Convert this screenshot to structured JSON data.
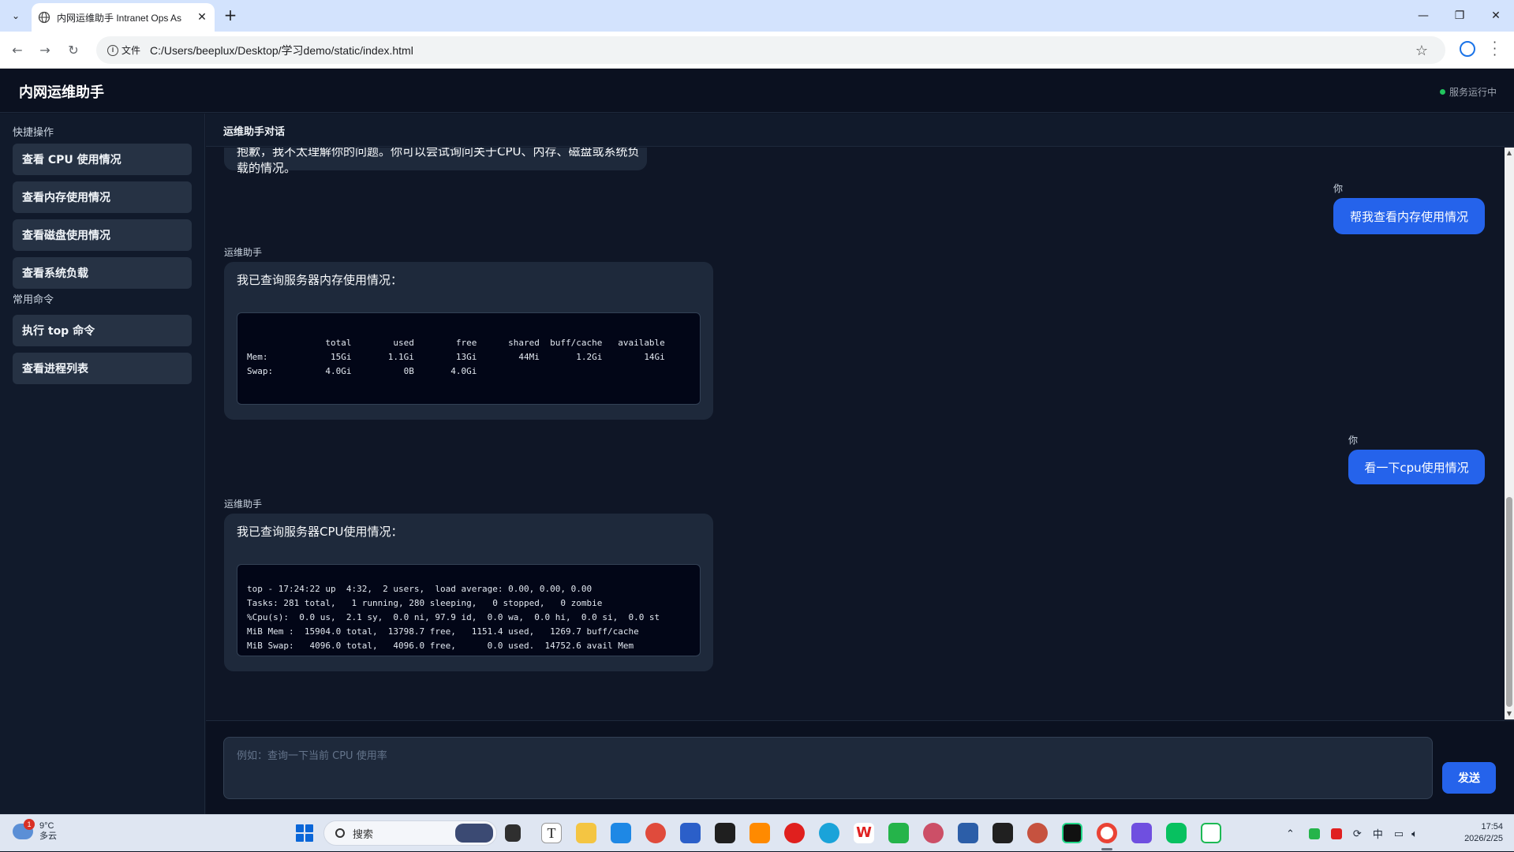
{
  "browser": {
    "tab_title": "内网运维助手 Intranet Ops As",
    "url_chip": "文件",
    "url": "C:/Users/beeplux/Desktop/学习demo/static/index.html"
  },
  "app": {
    "title": "内网运维助手",
    "status": "服务运行中",
    "accent": "#2563eb",
    "status_color": "#22c55e"
  },
  "sidebar": {
    "quick_title": "快捷操作",
    "quick_actions": [
      "查看 CPU 使用情况",
      "查看内存使用情况",
      "查看磁盘使用情况",
      "查看系统负载"
    ],
    "common_title": "常用命令",
    "commands": [
      "执行 top 命令",
      "查看进程列表"
    ]
  },
  "chat": {
    "header": "运维助手对话",
    "messages": [
      {
        "role": "assistant",
        "text": "抱歉，我不太理解你的问题。你可以尝试询问关于CPU、内存、磁盘或系统负载的情况。"
      },
      {
        "role": "user",
        "sender": "你",
        "text": "帮我查看内存使用情况"
      },
      {
        "role": "assistant",
        "sender": "运维助手",
        "text": "我已查询服务器内存使用情况：",
        "terminal": "               total        used        free      shared  buff/cache   available\nMem:            15Gi       1.1Gi        13Gi        44Mi       1.2Gi        14Gi\nSwap:          4.0Gi          0B       4.0Gi"
      },
      {
        "role": "user",
        "sender": "你",
        "text": "看一下cpu使用情况"
      },
      {
        "role": "assistant",
        "sender": "运维助手",
        "text": "我已查询服务器CPU使用情况：",
        "terminal": "top - 17:24:22 up  4:32,  2 users,  load average: 0.00, 0.00, 0.00\nTasks: 281 total,   1 running, 280 sleeping,   0 stopped,   0 zombie\n%Cpu(s):  0.0 us,  2.1 sy,  0.0 ni, 97.9 id,  0.0 wa,  0.0 hi,  0.0 si,  0.0 st\nMiB Mem :  15904.0 total,  13798.7 free,   1151.4 used,   1269.7 buff/cache\nMiB Swap:   4096.0 total,   4096.0 free,      0.0 used.  14752.6 avail Mem"
      }
    ]
  },
  "composer": {
    "placeholder": "例如：查询一下当前 CPU 使用率",
    "send_label": "发送"
  },
  "taskbar": {
    "temperature": "9°C",
    "weather": "多云",
    "weather_badge": "1",
    "search_label": "搜索",
    "ime": "中",
    "time": "17:54",
    "date": "2026/2/25",
    "apps": [
      "file-icon",
      "typora-icon",
      "file-explorer-icon",
      "screen-capture-icon",
      "chrome-canary-icon",
      "store-icon",
      "terminal-icon",
      "sublime-icon",
      "app-8-icon",
      "edge-icon",
      "wps-icon",
      "app-green-icon",
      "avatar-app-icon",
      "powershell-icon",
      "chatgpt-icon",
      "app-red-icon",
      "pycharm-icon",
      "chrome-icon",
      "app-purple-icon",
      "wechat-icon",
      "message-icon"
    ]
  }
}
